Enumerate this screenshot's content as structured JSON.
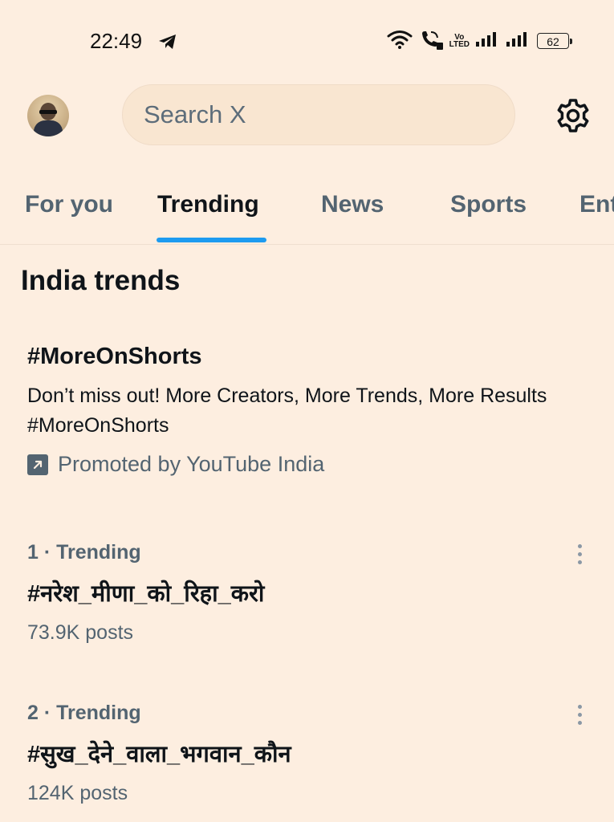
{
  "status_bar": {
    "time": "22:49",
    "volte_top": "Vo",
    "volte_bottom": "LTED",
    "battery": "62",
    "icons": [
      "telegram-icon",
      "wifi-icon",
      "wifi-call-icon",
      "volte-icon",
      "signal-icon",
      "signal-icon",
      "battery-icon"
    ]
  },
  "header": {
    "search_placeholder": "Search X",
    "icons": [
      "avatar",
      "gear-icon"
    ]
  },
  "tabs": [
    {
      "label": "For you",
      "active": false
    },
    {
      "label": "Trending",
      "active": true
    },
    {
      "label": "News",
      "active": false
    },
    {
      "label": "Sports",
      "active": false
    },
    {
      "label": "Ent",
      "active": false
    }
  ],
  "section": {
    "title": "India trends"
  },
  "promoted": {
    "tag": "#MoreOnShorts",
    "description": "Don’t miss out! More Creators, More Trends, More Results #MoreOnShorts",
    "by": "Promoted by YouTube India"
  },
  "trends": [
    {
      "meta": "1 · Trending",
      "name": "#नरेश_मीणा_को_रिहा_करो",
      "count": "73.9K posts"
    },
    {
      "meta": "2 · Trending",
      "name": "#सुख_देने_वाला_भगवान_कौन",
      "count": "124K posts"
    }
  ],
  "colors": {
    "background": "#fdeee0",
    "accent": "#1d9bf0",
    "secondary_text": "#536471"
  }
}
